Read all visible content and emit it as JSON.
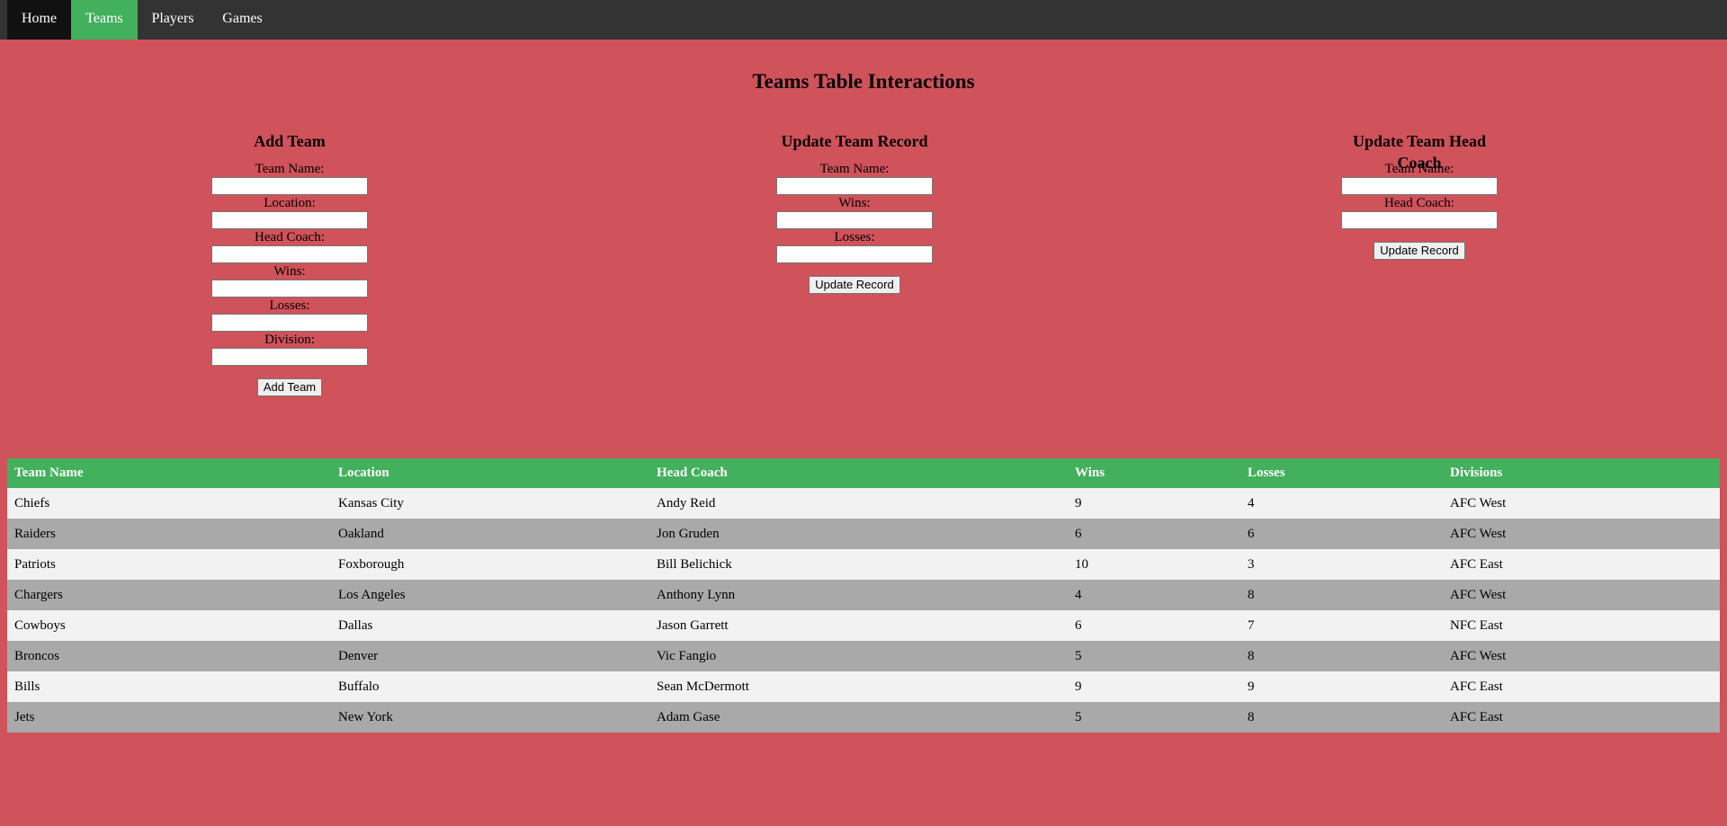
{
  "nav": {
    "items": [
      {
        "label": "Home",
        "active": false
      },
      {
        "label": "Teams",
        "active": true
      },
      {
        "label": "Players",
        "active": false
      },
      {
        "label": "Games",
        "active": false
      }
    ]
  },
  "colors": {
    "background": "#d0525a",
    "navbar": "#333333",
    "nav_active": "#42b05c",
    "table_header": "#42b05c",
    "row_light": "#f2f2f2",
    "row_dark": "#a9a9a9"
  },
  "page_title": "Teams Table Interactions",
  "forms": {
    "add_team": {
      "title": "Add Team",
      "fields": [
        {
          "label": "Team Name:",
          "value": ""
        },
        {
          "label": "Location:",
          "value": ""
        },
        {
          "label": "Head Coach:",
          "value": ""
        },
        {
          "label": "Wins:",
          "value": ""
        },
        {
          "label": "Losses:",
          "value": ""
        },
        {
          "label": "Division:",
          "value": ""
        }
      ],
      "button": "Add Team"
    },
    "update_record": {
      "title": "Update Team Record",
      "fields": [
        {
          "label": "Team Name:",
          "value": ""
        },
        {
          "label": "Wins:",
          "value": ""
        },
        {
          "label": "Losses:",
          "value": ""
        }
      ],
      "button": "Update Record"
    },
    "update_coach": {
      "title": "Update Team Head Coach",
      "fields": [
        {
          "label": "Team Name:",
          "value": ""
        },
        {
          "label": "Head Coach:",
          "value": ""
        }
      ],
      "button": "Update Record"
    }
  },
  "table": {
    "headers": [
      "Team Name",
      "Location",
      "Head Coach",
      "Wins",
      "Losses",
      "Divisions"
    ],
    "rows": [
      [
        "Chiefs",
        "Kansas City",
        "Andy Reid",
        "9",
        "4",
        "AFC West"
      ],
      [
        "Raiders",
        "Oakland",
        "Jon Gruden",
        "6",
        "6",
        "AFC West"
      ],
      [
        "Patriots",
        "Foxborough",
        "Bill Belichick",
        "10",
        "3",
        "AFC East"
      ],
      [
        "Chargers",
        "Los Angeles",
        "Anthony Lynn",
        "4",
        "8",
        "AFC West"
      ],
      [
        "Cowboys",
        "Dallas",
        "Jason Garrett",
        "6",
        "7",
        "NFC East"
      ],
      [
        "Broncos",
        "Denver",
        "Vic Fangio",
        "5",
        "8",
        "AFC West"
      ],
      [
        "Bills",
        "Buffalo",
        "Sean McDermott",
        "9",
        "9",
        "AFC East"
      ],
      [
        "Jets",
        "New York",
        "Adam Gase",
        "5",
        "8",
        "AFC East"
      ]
    ]
  }
}
